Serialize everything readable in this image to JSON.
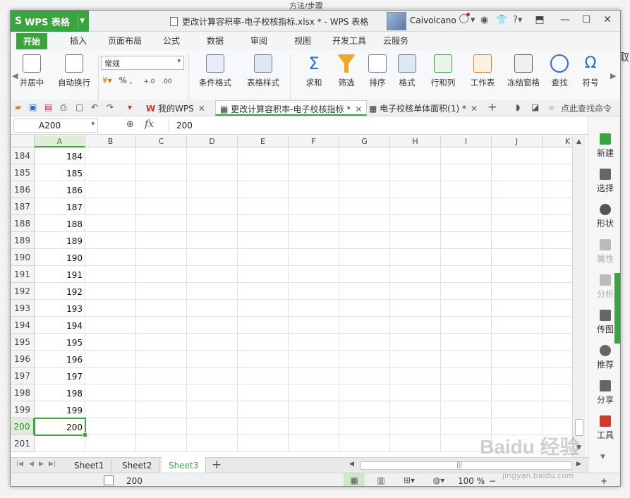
{
  "background": {
    "top_strip_text": "方法/步骤",
    "right_char": "取"
  },
  "app": {
    "name": "WPS 表格",
    "window_title": "更改计算容积率-电子校核指标.xlsx * - WPS 表格",
    "user_name": "Caivolcano",
    "accent_color": "#3aa53f"
  },
  "ribbon_tabs": [
    "开始",
    "插入",
    "页面布局",
    "公式",
    "数据",
    "审阅",
    "视图",
    "开发工具",
    "云服务"
  ],
  "ribbon": {
    "merge_label": "并居中",
    "wrap_label": "自动换行",
    "number_format": "常规",
    "fmt_row": "% ,",
    "cond_format": "条件格式",
    "table_style": "表格样式",
    "sum": "求和",
    "filter": "筛选",
    "sort": "排序",
    "format": "格式",
    "rows_cols": "行和列",
    "worksheet": "工作表",
    "freeze": "冻结窗格",
    "find": "查找",
    "symbol": "符号"
  },
  "doc_tabs": [
    {
      "label": "我的WPS",
      "active": false
    },
    {
      "label": "更改计算容积率-电子校核指标 *",
      "active": true
    },
    {
      "label": "电子校核单体面积(1) *",
      "active": false
    }
  ],
  "search_cmd": "点此查找命令",
  "formula_bar": {
    "name_box": "A200",
    "fx": "fx",
    "value": "200"
  },
  "columns": [
    "A",
    "B",
    "C",
    "D",
    "E",
    "F",
    "G",
    "H",
    "I",
    "J",
    "K"
  ],
  "rows": [
    {
      "num": "184",
      "a": "184"
    },
    {
      "num": "185",
      "a": "185"
    },
    {
      "num": "186",
      "a": "186"
    },
    {
      "num": "187",
      "a": "187"
    },
    {
      "num": "188",
      "a": "188"
    },
    {
      "num": "189",
      "a": "189"
    },
    {
      "num": "190",
      "a": "190"
    },
    {
      "num": "191",
      "a": "191"
    },
    {
      "num": "192",
      "a": "192"
    },
    {
      "num": "193",
      "a": "193"
    },
    {
      "num": "194",
      "a": "194"
    },
    {
      "num": "195",
      "a": "195"
    },
    {
      "num": "196",
      "a": "196"
    },
    {
      "num": "197",
      "a": "197"
    },
    {
      "num": "198",
      "a": "198"
    },
    {
      "num": "199",
      "a": "199"
    },
    {
      "num": "200",
      "a": "200"
    },
    {
      "num": "201",
      "a": ""
    }
  ],
  "active_row": "200",
  "task_pane": [
    {
      "label": "新建",
      "icon": "new-icon",
      "enabled": true
    },
    {
      "label": "选择",
      "icon": "select-icon",
      "enabled": true
    },
    {
      "label": "形状",
      "icon": "shape-icon",
      "enabled": true
    },
    {
      "label": "属性",
      "icon": "property-icon",
      "enabled": false
    },
    {
      "label": "分析",
      "icon": "analysis-icon",
      "enabled": false
    },
    {
      "label": "传图",
      "icon": "upload-image-icon",
      "enabled": true
    },
    {
      "label": "推荐",
      "icon": "recommend-icon",
      "enabled": true
    },
    {
      "label": "分享",
      "icon": "share-icon",
      "enabled": true
    },
    {
      "label": "工具",
      "icon": "toolbox-icon",
      "enabled": true
    }
  ],
  "sheets": [
    {
      "label": "Sheet1",
      "active": false
    },
    {
      "label": "Sheet2",
      "active": false
    },
    {
      "label": "Sheet3",
      "active": true
    }
  ],
  "status": {
    "value": "200",
    "zoom": "100 %"
  },
  "watermark": {
    "main": "Baidu 经验",
    "sub": "jingyan.baidu.com"
  }
}
